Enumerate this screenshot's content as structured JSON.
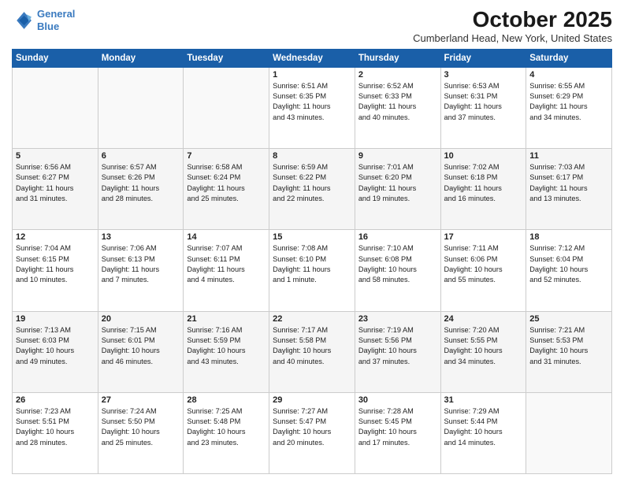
{
  "header": {
    "logo_line1": "General",
    "logo_line2": "Blue",
    "month": "October 2025",
    "location": "Cumberland Head, New York, United States"
  },
  "days_of_week": [
    "Sunday",
    "Monday",
    "Tuesday",
    "Wednesday",
    "Thursday",
    "Friday",
    "Saturday"
  ],
  "weeks": [
    [
      {
        "day": "",
        "info": ""
      },
      {
        "day": "",
        "info": ""
      },
      {
        "day": "",
        "info": ""
      },
      {
        "day": "1",
        "info": "Sunrise: 6:51 AM\nSunset: 6:35 PM\nDaylight: 11 hours\nand 43 minutes."
      },
      {
        "day": "2",
        "info": "Sunrise: 6:52 AM\nSunset: 6:33 PM\nDaylight: 11 hours\nand 40 minutes."
      },
      {
        "day": "3",
        "info": "Sunrise: 6:53 AM\nSunset: 6:31 PM\nDaylight: 11 hours\nand 37 minutes."
      },
      {
        "day": "4",
        "info": "Sunrise: 6:55 AM\nSunset: 6:29 PM\nDaylight: 11 hours\nand 34 minutes."
      }
    ],
    [
      {
        "day": "5",
        "info": "Sunrise: 6:56 AM\nSunset: 6:27 PM\nDaylight: 11 hours\nand 31 minutes."
      },
      {
        "day": "6",
        "info": "Sunrise: 6:57 AM\nSunset: 6:26 PM\nDaylight: 11 hours\nand 28 minutes."
      },
      {
        "day": "7",
        "info": "Sunrise: 6:58 AM\nSunset: 6:24 PM\nDaylight: 11 hours\nand 25 minutes."
      },
      {
        "day": "8",
        "info": "Sunrise: 6:59 AM\nSunset: 6:22 PM\nDaylight: 11 hours\nand 22 minutes."
      },
      {
        "day": "9",
        "info": "Sunrise: 7:01 AM\nSunset: 6:20 PM\nDaylight: 11 hours\nand 19 minutes."
      },
      {
        "day": "10",
        "info": "Sunrise: 7:02 AM\nSunset: 6:18 PM\nDaylight: 11 hours\nand 16 minutes."
      },
      {
        "day": "11",
        "info": "Sunrise: 7:03 AM\nSunset: 6:17 PM\nDaylight: 11 hours\nand 13 minutes."
      }
    ],
    [
      {
        "day": "12",
        "info": "Sunrise: 7:04 AM\nSunset: 6:15 PM\nDaylight: 11 hours\nand 10 minutes."
      },
      {
        "day": "13",
        "info": "Sunrise: 7:06 AM\nSunset: 6:13 PM\nDaylight: 11 hours\nand 7 minutes."
      },
      {
        "day": "14",
        "info": "Sunrise: 7:07 AM\nSunset: 6:11 PM\nDaylight: 11 hours\nand 4 minutes."
      },
      {
        "day": "15",
        "info": "Sunrise: 7:08 AM\nSunset: 6:10 PM\nDaylight: 11 hours\nand 1 minute."
      },
      {
        "day": "16",
        "info": "Sunrise: 7:10 AM\nSunset: 6:08 PM\nDaylight: 10 hours\nand 58 minutes."
      },
      {
        "day": "17",
        "info": "Sunrise: 7:11 AM\nSunset: 6:06 PM\nDaylight: 10 hours\nand 55 minutes."
      },
      {
        "day": "18",
        "info": "Sunrise: 7:12 AM\nSunset: 6:04 PM\nDaylight: 10 hours\nand 52 minutes."
      }
    ],
    [
      {
        "day": "19",
        "info": "Sunrise: 7:13 AM\nSunset: 6:03 PM\nDaylight: 10 hours\nand 49 minutes."
      },
      {
        "day": "20",
        "info": "Sunrise: 7:15 AM\nSunset: 6:01 PM\nDaylight: 10 hours\nand 46 minutes."
      },
      {
        "day": "21",
        "info": "Sunrise: 7:16 AM\nSunset: 5:59 PM\nDaylight: 10 hours\nand 43 minutes."
      },
      {
        "day": "22",
        "info": "Sunrise: 7:17 AM\nSunset: 5:58 PM\nDaylight: 10 hours\nand 40 minutes."
      },
      {
        "day": "23",
        "info": "Sunrise: 7:19 AM\nSunset: 5:56 PM\nDaylight: 10 hours\nand 37 minutes."
      },
      {
        "day": "24",
        "info": "Sunrise: 7:20 AM\nSunset: 5:55 PM\nDaylight: 10 hours\nand 34 minutes."
      },
      {
        "day": "25",
        "info": "Sunrise: 7:21 AM\nSunset: 5:53 PM\nDaylight: 10 hours\nand 31 minutes."
      }
    ],
    [
      {
        "day": "26",
        "info": "Sunrise: 7:23 AM\nSunset: 5:51 PM\nDaylight: 10 hours\nand 28 minutes."
      },
      {
        "day": "27",
        "info": "Sunrise: 7:24 AM\nSunset: 5:50 PM\nDaylight: 10 hours\nand 25 minutes."
      },
      {
        "day": "28",
        "info": "Sunrise: 7:25 AM\nSunset: 5:48 PM\nDaylight: 10 hours\nand 23 minutes."
      },
      {
        "day": "29",
        "info": "Sunrise: 7:27 AM\nSunset: 5:47 PM\nDaylight: 10 hours\nand 20 minutes."
      },
      {
        "day": "30",
        "info": "Sunrise: 7:28 AM\nSunset: 5:45 PM\nDaylight: 10 hours\nand 17 minutes."
      },
      {
        "day": "31",
        "info": "Sunrise: 7:29 AM\nSunset: 5:44 PM\nDaylight: 10 hours\nand 14 minutes."
      },
      {
        "day": "",
        "info": ""
      }
    ]
  ]
}
